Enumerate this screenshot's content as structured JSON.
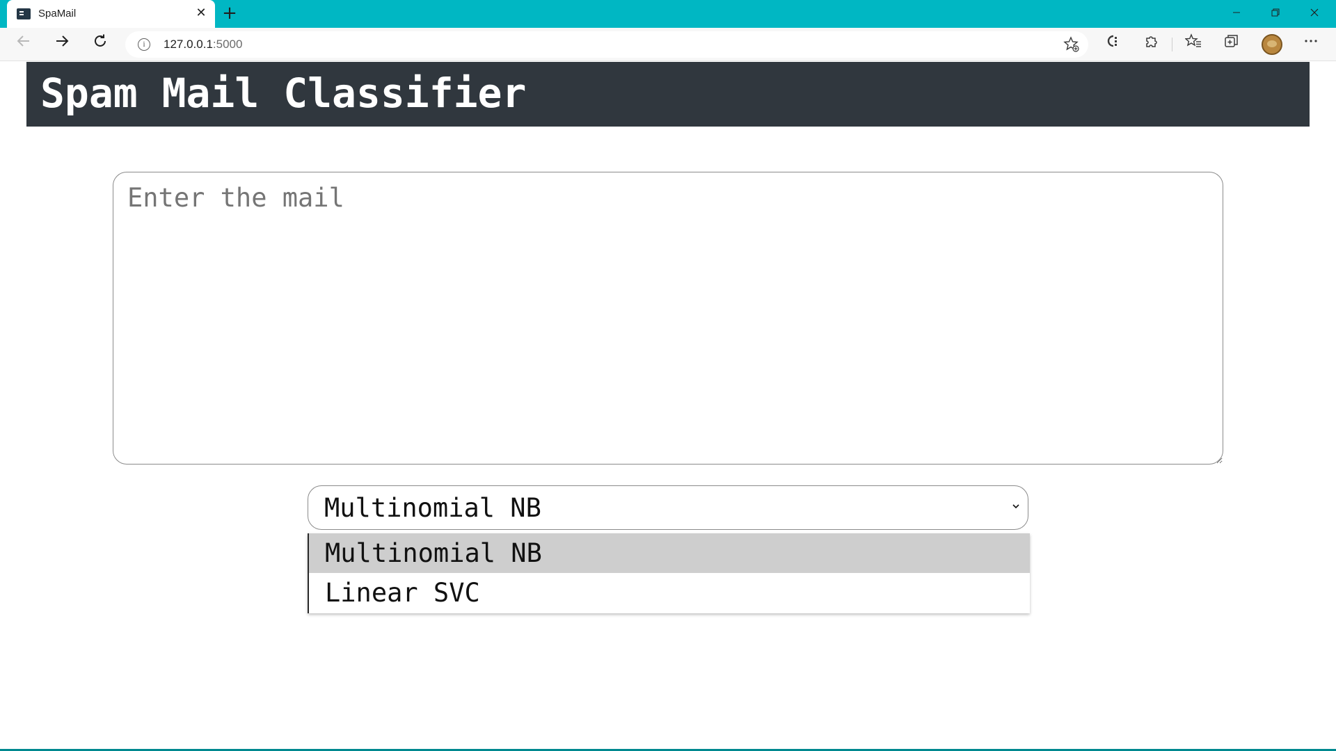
{
  "browser": {
    "tab_title": "SpaMail",
    "tab_close_glyph": "✕",
    "new_tab_glyph": "+",
    "url_host": "127.0.0.1",
    "url_port": ":5000",
    "accent_color": "#00b7c3",
    "icons": [
      "back-icon",
      "forward-icon",
      "refresh-icon",
      "info-icon",
      "add-favorite-icon",
      "copilot-icon",
      "extensions-icon",
      "favorites-icon",
      "collections-icon",
      "profile-avatar",
      "more-icon"
    ]
  },
  "header": {
    "title": "Spam Mail Classifier",
    "background_color": "#30373e"
  },
  "form": {
    "mail_placeholder": "Enter the mail",
    "mail_value": "",
    "model_select": {
      "selected": "Multinomial NB",
      "options": [
        "Multinomial NB",
        "Linear SVC"
      ],
      "highlighted_option": "Multinomial NB",
      "open": true
    }
  }
}
